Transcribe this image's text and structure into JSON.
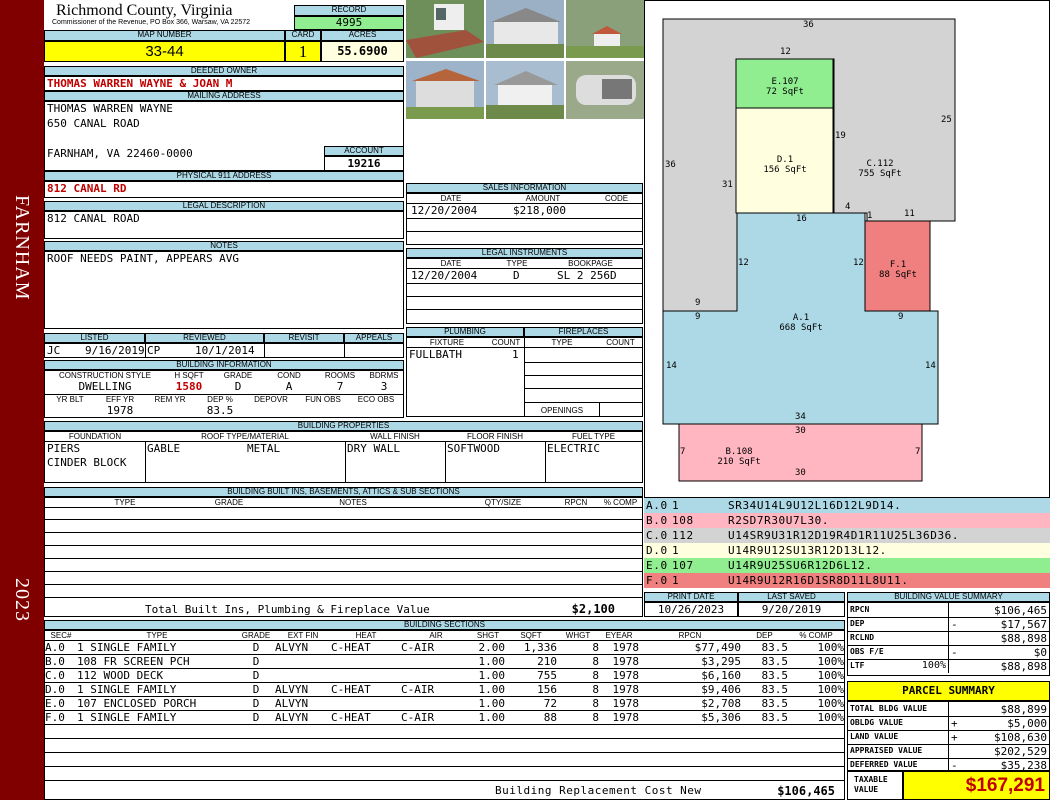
{
  "sidebar": {
    "district": "FARNHAM",
    "year": "2023"
  },
  "header": {
    "county": "Richmond County, Virginia",
    "commissioner": "Commissioner of the Revenue, PO Box 366, Warsaw, VA 22572",
    "record_label": "RECORD",
    "record": "4995",
    "map_label": "MAP NUMBER",
    "map": "33-44",
    "card_label": "CARD",
    "card": "1",
    "acres_label": "ACRES",
    "acres": "55.6900"
  },
  "owner": {
    "deeded_label": "DEEDED OWNER",
    "deeded": "THOMAS WARREN WAYNE & JOAN M",
    "mailing_label": "MAILING ADDRESS",
    "line1": "THOMAS WARREN WAYNE",
    "line2": "650 CANAL ROAD",
    "line3": "FARNHAM, VA 22460-0000",
    "account_label": "ACCOUNT",
    "account": "19216",
    "phys_label": "PHYSICAL 911 ADDRESS",
    "phys": "812 CANAL RD",
    "legal_label": "LEGAL DESCRIPTION",
    "legal": "812 CANAL ROAD",
    "notes_label": "NOTES",
    "notes": "ROOF NEEDS PAINT, APPEARS AVG"
  },
  "sales": {
    "title": "SALES INFORMATION",
    "h_date": "DATE",
    "h_amount": "AMOUNT",
    "h_code": "CODE",
    "date": "12/20/2004",
    "amount": "$218,000"
  },
  "legal_instr": {
    "title": "LEGAL INSTRUMENTS",
    "h_date": "DATE",
    "h_type": "TYPE",
    "h_book": "BOOKPAGE",
    "date": "12/20/2004",
    "type": "D",
    "book": "SL 2 256D"
  },
  "listing": {
    "h_listed": "LISTED",
    "h_reviewed": "REVIEWED",
    "h_revisit": "REVISIT",
    "h_appeals": "APPEALS",
    "listed_by": "JC",
    "listed": "9/16/2019",
    "reviewed_by": "CP",
    "reviewed": "10/1/2014"
  },
  "bldg_info": {
    "title": "BUILDING INFORMATION",
    "h_style": "CONSTRUCTION STYLE",
    "h_hsqft": "H SQFT",
    "h_grade": "GRADE",
    "h_cond": "COND",
    "h_rooms": "ROOMS",
    "h_bdrms": "BDRMS",
    "style": "DWELLING",
    "hsqft": "1580",
    "grade": "D",
    "cond": "A",
    "rooms": "7",
    "bdrms": "3",
    "h_yrblt": "YR BLT",
    "h_effyr": "EFF YR",
    "h_remyr": "REM YR",
    "h_dep": "DEP %",
    "h_depovr": "DEPOVR",
    "h_funobs": "FUN OBS",
    "h_ecoobs": "ECO OBS",
    "effyr": "1978",
    "dep": "83.5"
  },
  "plumbing": {
    "title": "PLUMBING",
    "h_fixture": "FIXTURE",
    "h_count": "COUNT",
    "fixture": "FULLBATH",
    "count": "1"
  },
  "fireplaces": {
    "title": "FIREPLACES",
    "h_type": "TYPE",
    "h_count": "COUNT",
    "openings": "OPENINGS"
  },
  "props": {
    "title": "BUILDING PROPERTIES",
    "h_found": "FOUNDATION",
    "h_roof": "ROOF TYPE/MATERIAL",
    "h_wall": "WALL FINISH",
    "h_floor": "FLOOR FINISH",
    "h_fuel": "FUEL TYPE",
    "found1": "PIERS",
    "found2": "CINDER BLOCK",
    "roof_type": "GABLE",
    "roof_mat": "METAL",
    "wall": "DRY WALL",
    "floor": "SOFTWOOD",
    "fuel": "ELECTRIC"
  },
  "builtins": {
    "title": "BUILDING BUILT INS, BASEMENTS, ATTICS & SUB SECTIONS",
    "h_type": "TYPE",
    "h_grade": "GRADE",
    "h_notes": "NOTES",
    "h_qty": "QTY/SIZE",
    "h_rpcn": "RPCN",
    "h_comp": "% COMP",
    "total_label": "Total Built Ins, Plumbing & Fireplace Value",
    "total": "$2,100"
  },
  "sketch": {
    "areas": [
      {
        "code": "E.107",
        "sqft": "72 SqFt"
      },
      {
        "code": "D.1",
        "sqft": "156 SqFt"
      },
      {
        "code": "C.112",
        "sqft": "755 SqFt"
      },
      {
        "code": "F.1",
        "sqft": "88 SqFt"
      },
      {
        "code": "A.1",
        "sqft": "668 SqFt"
      },
      {
        "code": "B.108",
        "sqft": "210 SqFt"
      }
    ],
    "dims": [
      "36",
      "12",
      "19",
      "25",
      "36",
      "31",
      "4",
      "1",
      "11",
      "16",
      "12",
      "12",
      "9",
      "9",
      "9",
      "14",
      "14",
      "34",
      "30",
      "7",
      "7",
      "30"
    ]
  },
  "vectors": [
    {
      "id": "A.0",
      "n": "1",
      "v": "SR34U14L9U12L16D12L9D14.",
      "color": "#add8e6"
    },
    {
      "id": "B.0",
      "n": "108",
      "v": "R2SD7R30U7L30.",
      "color": "#ffb6c1"
    },
    {
      "id": "C.0",
      "n": "112",
      "v": "U14SR9U31R12D19R4D1R11U25L36D36.",
      "color": "#d3d3d3"
    },
    {
      "id": "D.0",
      "n": "1",
      "v": "U14R9U12SU13R12D13L12.",
      "color": "#ffffe0"
    },
    {
      "id": "E.0",
      "n": "107",
      "v": "U14R9U25SU6R12D6L12.",
      "color": "#90ee90"
    },
    {
      "id": "F.0",
      "n": "1",
      "v": "U14R9U12R16D1SR8D11L8U11.",
      "color": "#f08080"
    }
  ],
  "print": {
    "h_print": "PRINT DATE",
    "h_saved": "LAST SAVED",
    "print": "10/26/2023",
    "saved": "9/20/2019"
  },
  "sections": {
    "title": "BUILDING SECTIONS",
    "headers": [
      "SEC#",
      "TYPE",
      "GRADE",
      "EXT FIN",
      "HEAT",
      "AIR",
      "SHGT",
      "SQFT",
      "WHGT",
      "EYEAR",
      "RPCN",
      "DEP",
      "% COMP"
    ],
    "rows": [
      [
        "A.0",
        "1 SINGLE FAMILY",
        "D",
        "ALVYN",
        "C-HEAT",
        "C-AIR",
        "2.00",
        "1,336",
        "8",
        "1978",
        "$77,490",
        "83.5",
        "100%"
      ],
      [
        "B.0",
        "108 FR SCREEN PCH",
        "D",
        "",
        "",
        "",
        "1.00",
        "210",
        "8",
        "1978",
        "$3,295",
        "83.5",
        "100%"
      ],
      [
        "C.0",
        "112 WOOD DECK",
        "D",
        "",
        "",
        "",
        "1.00",
        "755",
        "8",
        "1978",
        "$6,160",
        "83.5",
        "100%"
      ],
      [
        "D.0",
        "1 SINGLE FAMILY",
        "D",
        "ALVYN",
        "C-HEAT",
        "C-AIR",
        "1.00",
        "156",
        "8",
        "1978",
        "$9,406",
        "83.5",
        "100%"
      ],
      [
        "E.0",
        "107 ENCLOSED PORCH",
        "D",
        "ALVYN",
        "",
        "",
        "1.00",
        "72",
        "8",
        "1978",
        "$2,708",
        "83.5",
        "100%"
      ],
      [
        "F.0",
        "1 SINGLE FAMILY",
        "D",
        "ALVYN",
        "C-HEAT",
        "C-AIR",
        "1.00",
        "88",
        "8",
        "1978",
        "$5,306",
        "83.5",
        "100%"
      ]
    ],
    "replacement_label": "Building Replacement Cost New",
    "replacement": "$106,465"
  },
  "bvs": {
    "title": "BUILDING VALUE SUMMARY",
    "rows": [
      {
        "label": "RPCN",
        "sign": "",
        "pct": "",
        "value": "$106,465"
      },
      {
        "label": "DEP",
        "sign": "-",
        "pct": "",
        "value": "$17,567"
      },
      {
        "label": "RCLND",
        "sign": "",
        "pct": "",
        "value": "$88,898"
      },
      {
        "label": "OBS F/E",
        "sign": "-",
        "pct": "",
        "value": "$0"
      },
      {
        "label": "LTF",
        "sign": "",
        "pct": "100%",
        "value": "$88,898"
      }
    ]
  },
  "parcel": {
    "title": "PARCEL SUMMARY",
    "rows": [
      {
        "label": "TOTAL BLDG VALUE",
        "sign": "",
        "value": "$88,899"
      },
      {
        "label": "OBLDG VALUE",
        "sign": "+",
        "value": "$5,000"
      },
      {
        "label": "LAND VALUE",
        "sign": "+",
        "value": "$108,630"
      },
      {
        "label": "APPRAISED VALUE",
        "sign": "",
        "value": "$202,529"
      },
      {
        "label": "DEFERRED VALUE",
        "sign": "-",
        "value": "$35,238"
      }
    ],
    "taxable_label1": "TAXABLE",
    "taxable_label2": "VALUE",
    "taxable": "$167,291"
  }
}
